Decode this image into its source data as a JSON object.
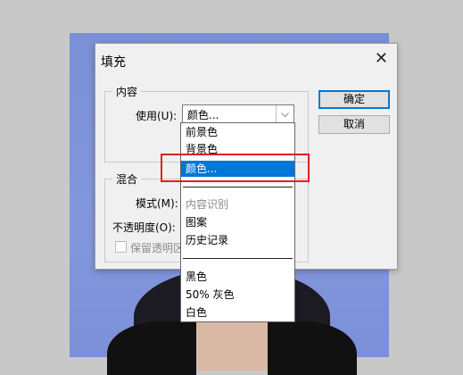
{
  "dialog": {
    "title": "填充",
    "ok_label": "确定",
    "cancel_label": "取消"
  },
  "content_group": {
    "label": "内容",
    "use_label": "使用(U):",
    "use_value": "颜色..."
  },
  "blend_group": {
    "label": "混合",
    "mode_label": "模式(M):",
    "opacity_label": "不透明度(O):",
    "preserve_label": "保留透明区"
  },
  "dropdown": {
    "options": [
      {
        "label": "前景色"
      },
      {
        "label": "背景色"
      },
      {
        "label": "颜色..."
      },
      {
        "label": "内容识别"
      },
      {
        "label": "图案"
      },
      {
        "label": "历史记录"
      },
      {
        "label": "黑色"
      },
      {
        "label": "50% 灰色"
      },
      {
        "label": "白色"
      }
    ]
  },
  "colors": {
    "selection": "#0078d7",
    "highlight_box": "#e02020"
  }
}
